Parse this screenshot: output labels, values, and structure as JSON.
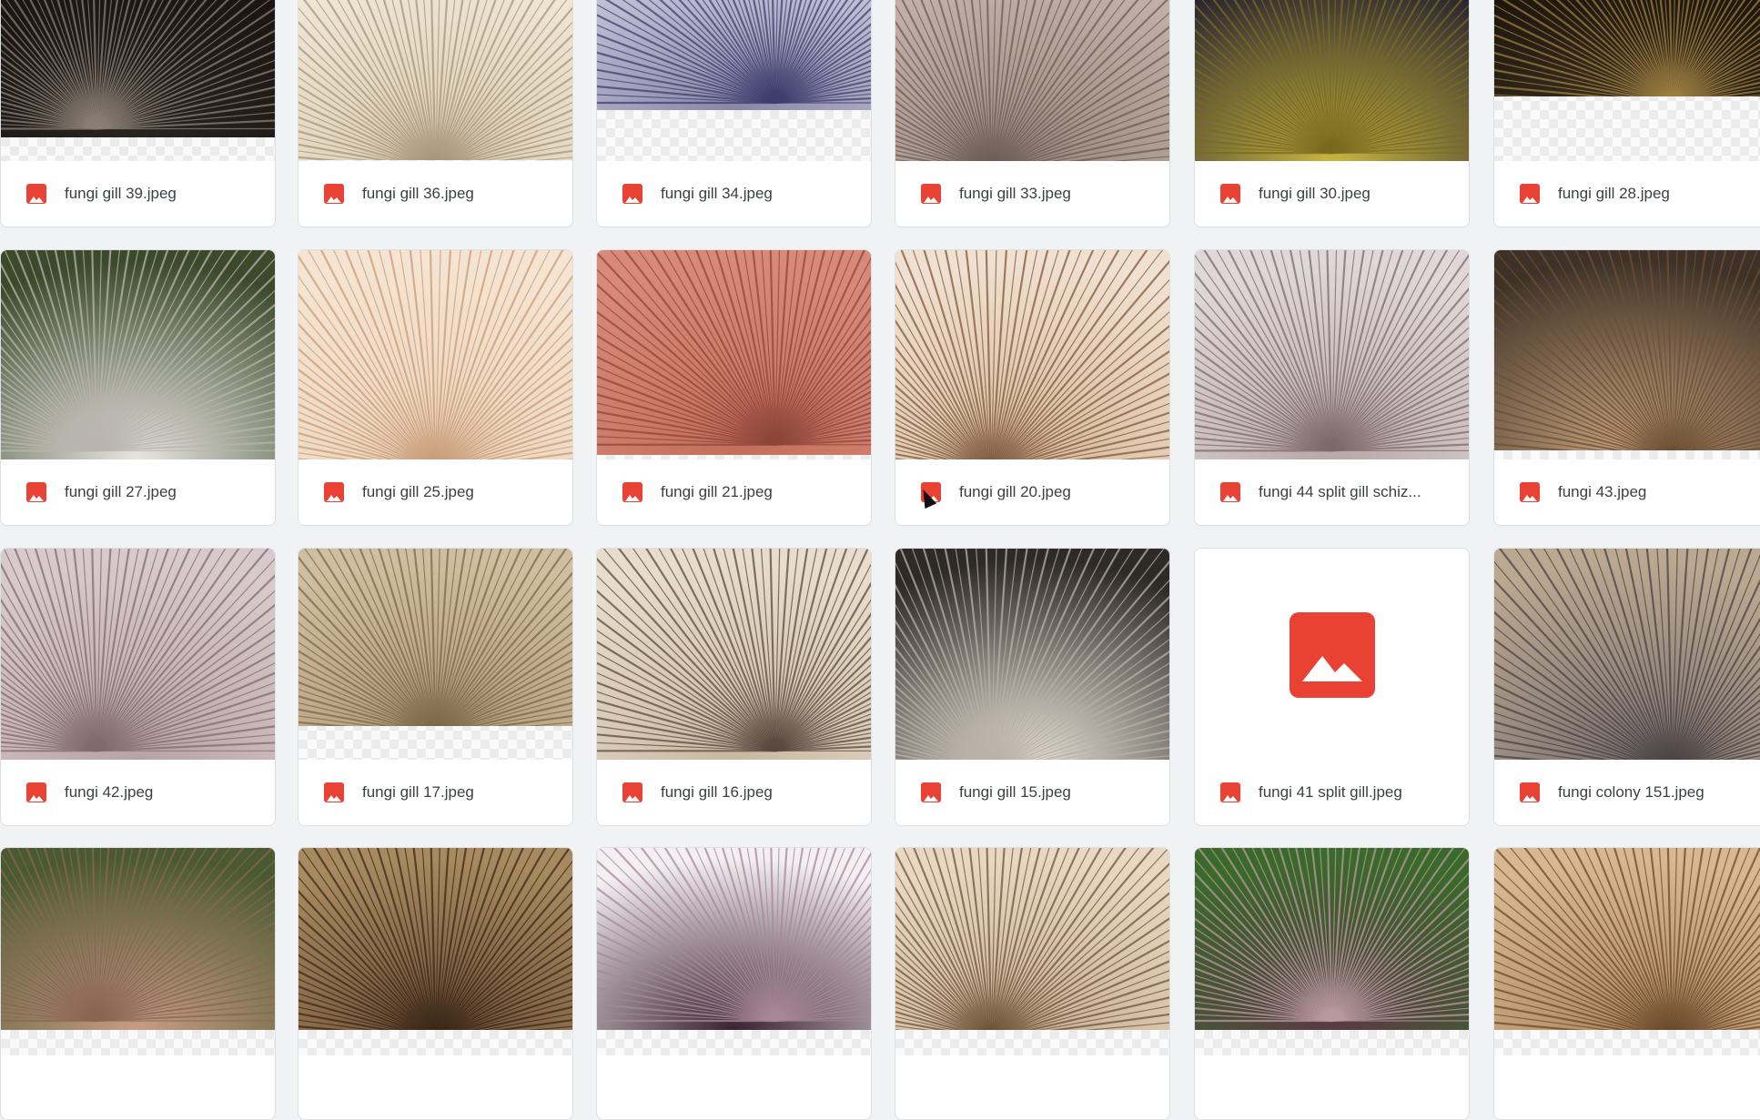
{
  "files": [
    {
      "name": "fungi gill 39.jpeg",
      "style": "dark-gills"
    },
    {
      "name": "fungi gill 36.jpeg",
      "style": "cream-wavy"
    },
    {
      "name": "fungi gill 34.jpeg",
      "style": "blue-violet"
    },
    {
      "name": "fungi gill 33.jpeg",
      "style": "grey-brown"
    },
    {
      "name": "fungi gill 30.jpeg",
      "style": "yellow-pores"
    },
    {
      "name": "fungi gill 28.jpeg",
      "style": "dark-radial"
    },
    {
      "name": "fungi gill 27.jpeg",
      "style": "white-radial"
    },
    {
      "name": "fungi gill 25.jpeg",
      "style": "peach-gills"
    },
    {
      "name": "fungi gill 21.jpeg",
      "style": "salmon-wavy"
    },
    {
      "name": "fungi gill 20.jpeg",
      "style": "tan-gills"
    },
    {
      "name": "fungi 44 split gill schiz...",
      "style": "split-gill-mauve"
    },
    {
      "name": "fungi 43.jpeg",
      "style": "tan-fan"
    },
    {
      "name": "fungi 42.jpeg",
      "style": "mauve-radial"
    },
    {
      "name": "fungi gill 17.jpeg",
      "style": "brown-layers"
    },
    {
      "name": "fungi gill 16.jpeg",
      "style": "field-mushrooms"
    },
    {
      "name": "fungi gill 15.jpeg",
      "style": "white-fans"
    },
    {
      "name": "fungi 41 split gill.jpeg",
      "style": "placeholder"
    },
    {
      "name": "fungi colony 151.jpeg",
      "style": "colony-grey"
    },
    {
      "name": "",
      "style": "cluster-peach"
    },
    {
      "name": "",
      "style": "brown-dome"
    },
    {
      "name": "",
      "style": "purple-dome"
    },
    {
      "name": "",
      "style": "beige-gills"
    },
    {
      "name": "",
      "style": "purple-grass"
    },
    {
      "name": "",
      "style": "tan-overlap"
    }
  ],
  "colors": {
    "image_icon": "#e94235",
    "filename_text": "#3c4043"
  },
  "icons": {
    "file_type_icon": "image-icon",
    "placeholder_icon": "image-placeholder-icon",
    "cursor": "mouse-cursor-icon"
  }
}
